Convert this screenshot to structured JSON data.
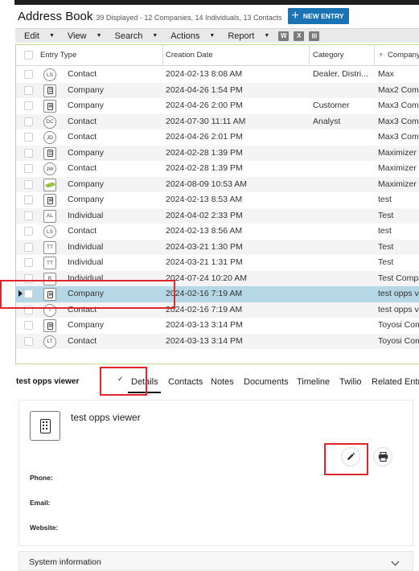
{
  "header": {
    "title": "Address Book",
    "counts": "39 Displayed - 12 Companies, 14 Individuals, 13 Contacts",
    "new_entry_label": "NEW ENTRY",
    "new_entry_icon": "plus-icon"
  },
  "menubar": {
    "items": [
      {
        "label": "Edit"
      },
      {
        "label": "View"
      },
      {
        "label": "Search"
      },
      {
        "label": "Actions"
      },
      {
        "label": "Report"
      }
    ],
    "export_icons": [
      {
        "name": "word-export-icon",
        "glyph": "W"
      },
      {
        "name": "excel-export-icon",
        "glyph": "X"
      },
      {
        "name": "xml-export-icon",
        "glyph": "⊞"
      }
    ]
  },
  "grid": {
    "columns": {
      "entry_type": "Entry Type",
      "creation_date": "Creation Date",
      "category": "Category",
      "company": "Company",
      "company_sort_icon": "+"
    },
    "rows": [
      {
        "icon_kind": "circle",
        "icon_text": "LS",
        "type": "Contact",
        "date": "2024-02-13 8:08 AM",
        "category": "Dealer, Distri...",
        "company": "Max"
      },
      {
        "icon_kind": "building",
        "icon_text": "",
        "type": "Company",
        "date": "2024-04-26 1:54 PM",
        "category": "",
        "company": "Max2 Comp"
      },
      {
        "icon_kind": "building",
        "icon_text": "",
        "type": "Company",
        "date": "2024-04-26 2:00 PM",
        "category": "Customer",
        "company": "Max3 Comp"
      },
      {
        "icon_kind": "circle",
        "icon_text": "DC",
        "type": "Contact",
        "date": "2024-07-30 11:11 AM",
        "category": "Analyst",
        "company": "Max3 Comp"
      },
      {
        "icon_kind": "circle",
        "icon_text": "JD",
        "type": "Contact",
        "date": "2024-04-26 2:01 PM",
        "category": "",
        "company": "Max3 Comp"
      },
      {
        "icon_kind": "building",
        "icon_text": "",
        "type": "Company",
        "date": "2024-02-28 1:39 PM",
        "category": "",
        "company": "Maximizer"
      },
      {
        "icon_kind": "circle",
        "icon_text": "JW",
        "type": "Contact",
        "date": "2024-02-28 1:39 PM",
        "category": "",
        "company": "Maximizer"
      },
      {
        "icon_kind": "leaf",
        "icon_text": "",
        "type": "Company",
        "date": "2024-08-09 10:53 AM",
        "category": "",
        "company": "Maximizer"
      },
      {
        "icon_kind": "building",
        "icon_text": "",
        "type": "Company",
        "date": "2024-02-13 8:53 AM",
        "category": "",
        "company": "test"
      },
      {
        "icon_kind": "square",
        "icon_text": "AL",
        "type": "Individual",
        "date": "2024-04-02 2:33 PM",
        "category": "",
        "company": "Test"
      },
      {
        "icon_kind": "circle",
        "icon_text": "LS",
        "type": "Contact",
        "date": "2024-02-13 8:56 AM",
        "category": "",
        "company": "test"
      },
      {
        "icon_kind": "square",
        "icon_text": "TT",
        "type": "Individual",
        "date": "2024-03-21 1:30 PM",
        "category": "",
        "company": "Test"
      },
      {
        "icon_kind": "square",
        "icon_text": "TT",
        "type": "Individual",
        "date": "2024-03-21 1:31 PM",
        "category": "",
        "company": "Test"
      },
      {
        "icon_kind": "square",
        "icon_text": "R",
        "type": "Individual",
        "date": "2024-07-24 10:20 AM",
        "category": "",
        "company": "Test Compa"
      },
      {
        "icon_kind": "building",
        "icon_text": "",
        "type": "Company",
        "date": "2024-02-16 7:19 AM",
        "category": "",
        "company": "test opps v",
        "selected": true
      },
      {
        "icon_kind": "circle",
        "icon_text": "T",
        "type": "Contact",
        "date": "2024-02-16 7:19 AM",
        "category": "",
        "company": "test opps v"
      },
      {
        "icon_kind": "building",
        "icon_text": "",
        "type": "Company",
        "date": "2024-03-13 3:14 PM",
        "category": "",
        "company": "Toyosi Com"
      },
      {
        "icon_kind": "circle",
        "icon_text": "LT",
        "type": "Contact",
        "date": "2024-03-13 3:14 PM",
        "category": "",
        "company": "Toyosi Com"
      }
    ]
  },
  "details": {
    "entry_name": "test opps viewer",
    "tabs": [
      {
        "label": "Details",
        "active": true
      },
      {
        "label": "Contacts"
      },
      {
        "label": "Notes"
      },
      {
        "label": "Documents"
      },
      {
        "label": "Timeline"
      },
      {
        "label": "Twilio"
      },
      {
        "label": "Related Entries"
      }
    ],
    "card_title": "test opps viewer",
    "fields": {
      "phone": "Phone:",
      "email": "Email:",
      "website": "Website:"
    },
    "edit_icon": "pencil-icon",
    "print_icon": "printer-icon",
    "system_info_label": "System information"
  },
  "colors": {
    "accent": "#1c73b4",
    "selected_row": "#b6d7e6",
    "highlight_box": "#e0252b",
    "grid_border": "#b9dc8a"
  }
}
